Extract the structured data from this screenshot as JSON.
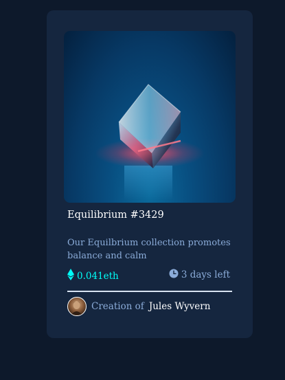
{
  "card": {
    "title": "Equilibrium #3429",
    "description": "Our Equilbrium collection promotes balance and calm",
    "price": "0.041eth",
    "time_left": "3 days left",
    "creator_prefix": "Creation of",
    "creator_name": "Jules Wyvern"
  },
  "icons": {
    "price": "ethereum-icon",
    "time": "clock-icon",
    "avatar": "avatar"
  },
  "colors": {
    "page_background": "#0d192b",
    "card_background": "#15263f",
    "accent_cyan": "#00fff8",
    "soft_blue": "#8bacd9",
    "white": "#ffffff"
  }
}
